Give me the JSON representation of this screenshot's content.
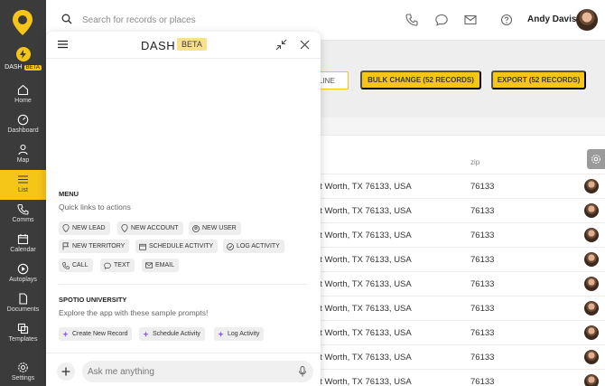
{
  "sidebar": {
    "dash_label": "DASH",
    "dash_beta": "BETA",
    "items": [
      {
        "label": "Home",
        "icon": "home-icon"
      },
      {
        "label": "Dashboard",
        "icon": "gauge-icon"
      },
      {
        "label": "Map",
        "icon": "map-pin-icon"
      },
      {
        "label": "List",
        "icon": "list-icon",
        "active": true
      },
      {
        "label": "Comms",
        "icon": "phone-icon"
      },
      {
        "label": "Calendar",
        "icon": "calendar-icon"
      },
      {
        "label": "Autoplays",
        "icon": "play-circle-icon"
      },
      {
        "label": "Documents",
        "icon": "document-icon"
      },
      {
        "label": "Templates",
        "icon": "templates-icon"
      },
      {
        "label": "Settings",
        "icon": "gear-icon"
      }
    ]
  },
  "topbar": {
    "search_placeholder": "Search for records or places",
    "user_name": "Andy Davis"
  },
  "main": {
    "outline_button_stub": "LINE",
    "bulk_change_label": "BULK CHANGE (52 RECORDS)",
    "export_label": "EXPORT (52 RECORDS)",
    "zip_header": "zip",
    "rows": [
      {
        "address": "rt Worth, TX 76133, USA",
        "zip": "76133"
      },
      {
        "address": "rt Worth, TX 76133, USA",
        "zip": "76133"
      },
      {
        "address": "rt Worth, TX 76133, USA",
        "zip": "76133"
      },
      {
        "address": "rt Worth, TX 76133, USA",
        "zip": "76133"
      },
      {
        "address": "rt Worth, TX 76133, USA",
        "zip": "76133"
      },
      {
        "address": "rt Worth, TX 76133, USA",
        "zip": "76133"
      },
      {
        "address": "rt Worth, TX 76133, USA",
        "zip": "76133"
      },
      {
        "address": "rt Worth, TX 76133, USA",
        "zip": "76133"
      },
      {
        "address": "rt Worth, TX 76133, USA",
        "zip": "76133"
      }
    ]
  },
  "panel": {
    "title": "DASH",
    "beta": "BETA",
    "menu_title": "MENU",
    "menu_sub": "Quick links to actions",
    "actions": [
      {
        "label": "NEW LEAD",
        "icon": "map-pin-icon"
      },
      {
        "label": "NEW ACCOUNT",
        "icon": "map-pin-icon"
      },
      {
        "label": "NEW USER",
        "icon": "user-icon"
      },
      {
        "label": "NEW TERRITORY",
        "icon": "flag-icon"
      },
      {
        "label": "SCHEDULE ACTIVITY",
        "icon": "calendar-icon"
      },
      {
        "label": "LOG ACTIVITY",
        "icon": "check-circle-icon"
      },
      {
        "label": "CALL",
        "icon": "phone-icon"
      },
      {
        "label": "TEXT",
        "icon": "chat-icon"
      },
      {
        "label": "EMAIL",
        "icon": "mail-icon"
      }
    ],
    "university_title": "SPOTIO UNIVERSITY",
    "university_sub": "Explore the app with these sample prompts!",
    "prompts": [
      {
        "label": "Create New Record"
      },
      {
        "label": "Schedule Activity"
      },
      {
        "label": "Log Activity"
      }
    ],
    "ask_placeholder": "Ask me anything"
  },
  "colors": {
    "accent": "#f5c518",
    "sidebar_bg": "#3b3b3b",
    "sparkle": "#8b5cf6"
  }
}
